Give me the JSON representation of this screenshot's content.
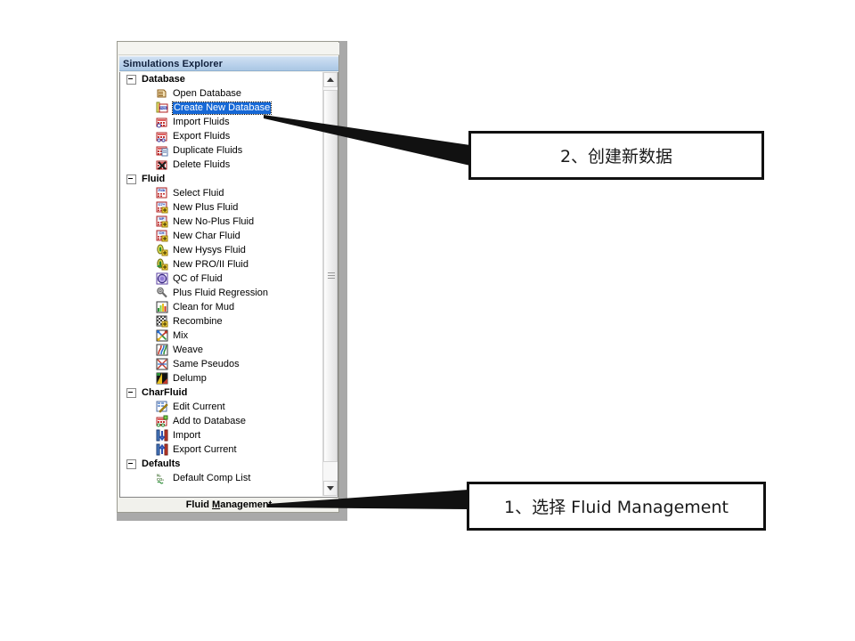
{
  "panel": {
    "title": "Simulations Explorer",
    "bottom_bar_label": "Fluid Management",
    "bottom_bar_accelerator": "M"
  },
  "colors": {
    "selection_blue": "#1668d6",
    "title_bar_blue": "#bcd3ec",
    "window_shadow": "#a9a9a9",
    "callout_border": "#111111"
  },
  "tree": {
    "groups": [
      {
        "label": "Database",
        "expanded": true,
        "toggle_icon": "minus-box-icon",
        "items": [
          {
            "label": "Open Database",
            "icon": "open-database-icon",
            "selected": false
          },
          {
            "label": "Create New Database",
            "icon": "create-new-database-icon",
            "selected": true
          },
          {
            "label": "Import Fluids",
            "icon": "import-fluids-icon",
            "selected": false
          },
          {
            "label": "Export Fluids",
            "icon": "export-fluids-icon",
            "selected": false
          },
          {
            "label": "Duplicate Fluids",
            "icon": "duplicate-fluids-icon",
            "selected": false
          },
          {
            "label": "Delete Fluids",
            "icon": "delete-fluids-icon",
            "selected": false
          }
        ]
      },
      {
        "label": "Fluid",
        "expanded": true,
        "toggle_icon": "minus-box-icon",
        "items": [
          {
            "label": "Select Fluid",
            "icon": "select-fluid-icon",
            "selected": false
          },
          {
            "label": "New Plus Fluid",
            "icon": "new-plus-fluid-icon",
            "selected": false
          },
          {
            "label": "New No-Plus Fluid",
            "icon": "new-no-plus-fluid-icon",
            "selected": false
          },
          {
            "label": "New Char Fluid",
            "icon": "new-char-fluid-icon",
            "selected": false
          },
          {
            "label": "New Hysys Fluid",
            "icon": "new-hysys-fluid-icon",
            "selected": false
          },
          {
            "label": "New PRO/II Fluid",
            "icon": "new-proii-fluid-icon",
            "selected": false
          },
          {
            "label": "QC of Fluid",
            "icon": "qc-of-fluid-icon",
            "selected": false
          },
          {
            "label": "Plus Fluid Regression",
            "icon": "plus-fluid-regression-icon",
            "selected": false
          },
          {
            "label": "Clean for Mud",
            "icon": "clean-for-mud-icon",
            "selected": false
          },
          {
            "label": "Recombine",
            "icon": "recombine-icon",
            "selected": false
          },
          {
            "label": "Mix",
            "icon": "mix-icon",
            "selected": false
          },
          {
            "label": "Weave",
            "icon": "weave-icon",
            "selected": false
          },
          {
            "label": "Same Pseudos",
            "icon": "same-pseudos-icon",
            "selected": false
          },
          {
            "label": "Delump",
            "icon": "delump-icon",
            "selected": false
          }
        ]
      },
      {
        "label": "CharFluid",
        "expanded": true,
        "toggle_icon": "minus-box-icon",
        "items": [
          {
            "label": "Edit Current",
            "icon": "edit-current-icon",
            "selected": false
          },
          {
            "label": "Add to Database",
            "icon": "add-to-database-icon",
            "selected": false
          },
          {
            "label": "Import",
            "icon": "import-icon",
            "selected": false
          },
          {
            "label": "Export Current",
            "icon": "export-current-icon",
            "selected": false
          }
        ]
      },
      {
        "label": "Defaults",
        "expanded": true,
        "toggle_icon": "minus-box-icon",
        "items": [
          {
            "label": "Default Comp List",
            "icon": "default-comp-list-icon",
            "selected": false
          }
        ]
      }
    ]
  },
  "scrollbar": {
    "up_arrow": "scroll-up-arrow-icon",
    "down_arrow": "scroll-down-arrow-icon",
    "grip": "scrollbar-grip-icon"
  },
  "callouts": [
    {
      "id": "callout-2",
      "text": "2、创建新数据"
    },
    {
      "id": "callout-1",
      "text": "1、选择 Fluid Management"
    }
  ]
}
